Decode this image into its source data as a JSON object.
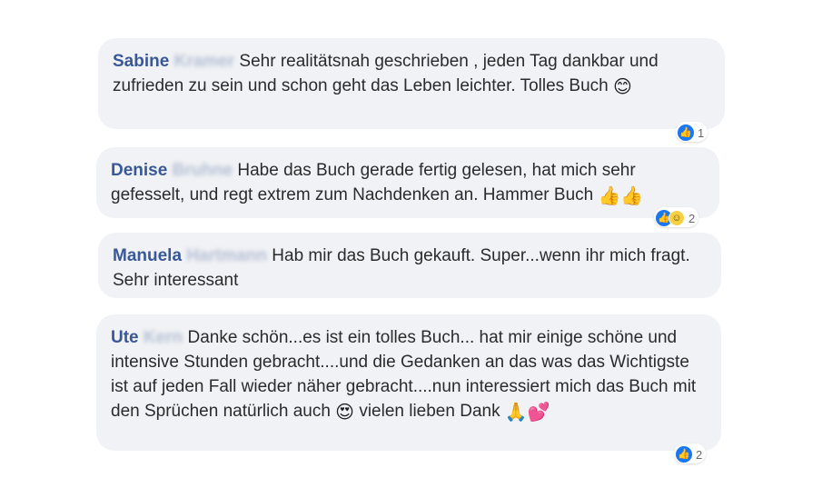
{
  "comments": [
    {
      "author_first": "Sabine",
      "author_last": "Kramer",
      "text": "Sehr realitätsnah geschrieben , jeden Tag dankbar und zufrieden zu sein und schon geht das Leben leichter. Tolles Buch",
      "emoji_end": "😊",
      "reaction_icons": [
        "like-icon"
      ],
      "reaction_count": "1"
    },
    {
      "author_first": "Denise",
      "author_last": "Bruhne",
      "text": "Habe das Buch gerade fertig gelesen, hat mich sehr gefesselt, und regt extrem zum Nachdenken an. Hammer Buch",
      "emoji_end": "👍👍",
      "reaction_icons": [
        "like-icon",
        "haha-icon"
      ],
      "reaction_count": "2"
    },
    {
      "author_first": "Manuela",
      "author_last": "Hartmann",
      "text": "Hab mir das Buch gekauft. Super...wenn ihr mich fragt. Sehr interessant",
      "emoji_end": "",
      "reaction_icons": [],
      "reaction_count": ""
    },
    {
      "author_first": "Ute",
      "author_last": "Kern",
      "text_a": "Danke schön...es ist ein tolles Buch... hat mir einige schöne und intensive Stunden gebracht....und die Gedanken an das was das Wichtigste ist auf jeden Fall wieder näher gebracht....nun interessiert mich das Buch mit den Sprüchen natürlich auch",
      "emoji_mid": "😍",
      "text_b": "vielen lieben Dank",
      "emoji_end": "🙏💕",
      "reaction_icons": [
        "like-icon"
      ],
      "reaction_count": "2"
    }
  ],
  "colors": {
    "bubble_bg": "#f0f2f5",
    "author_name": "#385898",
    "like_blue": "#1877f2"
  }
}
